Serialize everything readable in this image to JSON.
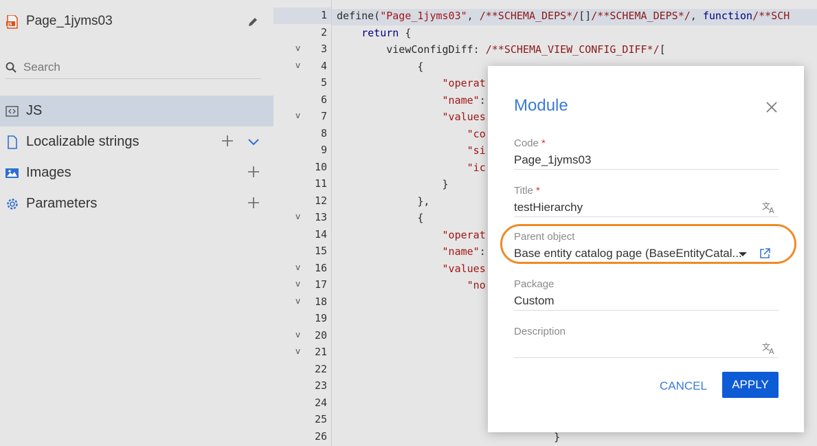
{
  "sidebar": {
    "title": "Page_1jyms03",
    "search_placeholder": "Search",
    "items": [
      {
        "label": "JS"
      },
      {
        "label": "Localizable strings"
      },
      {
        "label": "Images"
      },
      {
        "label": "Parameters"
      }
    ]
  },
  "editor": {
    "line_numbers": [
      "1",
      "2",
      "3",
      "4",
      "5",
      "6",
      "7",
      "8",
      "9",
      "10",
      "11",
      "12",
      "13",
      "14",
      "15",
      "16",
      "17",
      "18",
      "19",
      "20",
      "21",
      "22",
      "23",
      "24",
      "25",
      "26"
    ],
    "fold_lines": [
      3,
      4,
      7,
      13,
      16,
      17,
      18,
      20,
      21
    ],
    "lines": [
      [
        [
          "define(",
          ""
        ],
        [
          "\"Page_1jyms03\"",
          "str"
        ],
        [
          ", ",
          ""
        ],
        [
          "/**SCHEMA_DEPS*/",
          "cm"
        ],
        [
          "[]",
          ""
        ],
        [
          "/**SCHEMA_DEPS*/",
          "cm"
        ],
        [
          ", ",
          ""
        ],
        [
          "function",
          "kw"
        ],
        [
          "/**SCH",
          "cm"
        ]
      ],
      [
        [
          "    ",
          ""
        ],
        [
          "return",
          "kw"
        ],
        [
          " {",
          ""
        ]
      ],
      [
        [
          "        viewConfigDiff: ",
          ""
        ],
        [
          "/**SCHEMA_VIEW_CONFIG_DIFF*/",
          "cm"
        ],
        [
          "[",
          ""
        ]
      ],
      [
        [
          "             {",
          ""
        ]
      ],
      [
        [
          "                 ",
          ""
        ],
        [
          "\"operat",
          "str"
        ]
      ],
      [
        [
          "                 ",
          ""
        ],
        [
          "\"name\"",
          "str"
        ],
        [
          ":",
          ""
        ]
      ],
      [
        [
          "                 ",
          ""
        ],
        [
          "\"values",
          "str"
        ]
      ],
      [
        [
          "                     ",
          ""
        ],
        [
          "\"co",
          "str"
        ]
      ],
      [
        [
          "                     ",
          ""
        ],
        [
          "\"si",
          "str"
        ]
      ],
      [
        [
          "                     ",
          ""
        ],
        [
          "\"ic",
          "str"
        ]
      ],
      [
        [
          "                 }",
          ""
        ]
      ],
      [
        [
          "             },",
          ""
        ]
      ],
      [
        [
          "             {",
          ""
        ]
      ],
      [
        [
          "                 ",
          ""
        ],
        [
          "\"operat",
          "str"
        ]
      ],
      [
        [
          "                 ",
          ""
        ],
        [
          "\"name\"",
          "str"
        ],
        [
          ":",
          ""
        ]
      ],
      [
        [
          "                 ",
          ""
        ],
        [
          "\"values",
          "str"
        ]
      ],
      [
        [
          "                     ",
          ""
        ],
        [
          "\"no",
          "str"
        ]
      ],
      [
        [
          "",
          ""
        ]
      ],
      [
        [
          "",
          ""
        ]
      ],
      [
        [
          "",
          ""
        ]
      ],
      [
        [
          "",
          ""
        ]
      ],
      [
        [
          "",
          ""
        ]
      ],
      [
        [
          "",
          ""
        ]
      ],
      [
        [
          "",
          ""
        ]
      ],
      [
        [
          "",
          ""
        ]
      ],
      [
        [
          "                                   }",
          ""
        ]
      ]
    ]
  },
  "dialog": {
    "title": "Module",
    "fields": {
      "code": {
        "label": "Code",
        "required": "*",
        "value": "Page_1jyms03"
      },
      "title": {
        "label": "Title",
        "required": "*",
        "value": "testHierarchy"
      },
      "parent": {
        "label": "Parent object",
        "value": "Base entity catalog page (BaseEntityCatal..."
      },
      "package": {
        "label": "Package",
        "value": "Custom"
      },
      "description": {
        "label": "Description",
        "value": ""
      }
    },
    "cancel_label": "CANCEL",
    "apply_label": "APPLY"
  },
  "colors": {
    "accent": "#3a7bd5",
    "apply_bg": "#0e5bd6",
    "highlight_ring": "#f08a24",
    "required": "#e5342f"
  },
  "icons": {
    "file": "js-file-icon",
    "edit": "pencil-icon",
    "search": "search-icon",
    "js": "code-icon",
    "strings": "document-icon",
    "images": "image-icon",
    "parameters": "gear-icon",
    "close": "close-icon",
    "translate": "translate-icon",
    "dropdown": "caret-down-icon",
    "open": "external-link-icon"
  }
}
